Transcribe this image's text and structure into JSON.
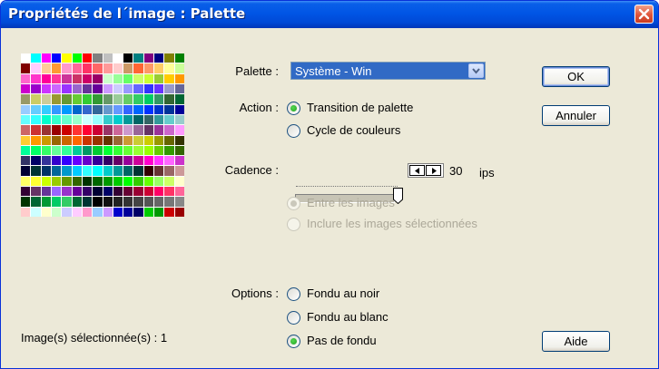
{
  "window": {
    "title": "Propriétés de l´image : Palette"
  },
  "palette_swatch_colors": [
    "#fff",
    "#00ffff",
    "#ff00ff",
    "#0000ff",
    "#ffff00",
    "#00ff00",
    "#ff0000",
    "#808080",
    "#c0c0c0",
    "#fff",
    "#000",
    "#008080",
    "#800080",
    "#000080",
    "#808000",
    "#008000",
    "#800000",
    "#ffccff",
    "#ffcc99",
    "#ff9933",
    "#ff99cc",
    "#ff6699",
    "#ff3366",
    "#ff6666",
    "#ff9999",
    "#ffcccc",
    "#cc9966",
    "#ff6633",
    "#ff9966",
    "#ffcc66",
    "#ffff99",
    "#ccff99",
    "#ff66cc",
    "#ff33cc",
    "#ff0099",
    "#ff3399",
    "#cc3399",
    "#cc3366",
    "#cc0066",
    "#990066",
    "#ccffcc",
    "#99ff99",
    "#66ff66",
    "#ccff66",
    "#ccff33",
    "#99cc33",
    "#ffcc00",
    "#ff9900",
    "#cc00cc",
    "#9900cc",
    "#cc33ff",
    "#cc66ff",
    "#9933ff",
    "#9966cc",
    "#663399",
    "#660099",
    "#cc99ff",
    "#ccccff",
    "#9999ff",
    "#6666ff",
    "#3333ff",
    "#6633ff",
    "#9999cc",
    "#666699",
    "#999966",
    "#cccc66",
    "#cccc99",
    "#999933",
    "#669933",
    "#66cc33",
    "#33cc33",
    "#339933",
    "#669966",
    "#99cc99",
    "#66cc66",
    "#33cc66",
    "#00cc66",
    "#339966",
    "#336633",
    "#006633",
    "#99ccff",
    "#66ccff",
    "#33ccff",
    "#3399ff",
    "#0099ff",
    "#0066cc",
    "#3366cc",
    "#336699",
    "#6699cc",
    "#6699ff",
    "#3366ff",
    "#0066ff",
    "#0033ff",
    "#0033cc",
    "#003399",
    "#000099",
    "#66ffff",
    "#33ffff",
    "#00ffcc",
    "#33ffcc",
    "#66ffcc",
    "#99ffcc",
    "#ccffff",
    "#99ffff",
    "#33cccc",
    "#00cccc",
    "#009999",
    "#006666",
    "#336666",
    "#339999",
    "#66cccc",
    "#99cccc",
    "#cc6666",
    "#cc3333",
    "#993333",
    "#990000",
    "#cc0000",
    "#ff3333",
    "#ff0033",
    "#cc0033",
    "#993366",
    "#cc6699",
    "#cc99cc",
    "#996699",
    "#663366",
    "#993399",
    "#cc66cc",
    "#ff99ff",
    "#ffcc33",
    "#ff9900",
    "#cc9900",
    "#996600",
    "#cc6600",
    "#ff6600",
    "#cc3300",
    "#993300",
    "#663300",
    "#996633",
    "#cc9933",
    "#cccc33",
    "#cccc00",
    "#999900",
    "#666600",
    "#333300",
    "#00ff99",
    "#00ff66",
    "#33ff66",
    "#66ff99",
    "#33ff99",
    "#00cc99",
    "#009966",
    "#00cc33",
    "#00ff33",
    "#33ff33",
    "#66ff33",
    "#99ff33",
    "#99ff00",
    "#66cc00",
    "#339900",
    "#336600",
    "#333366",
    "#000066",
    "#333399",
    "#3300cc",
    "#3300ff",
    "#6600ff",
    "#6600cc",
    "#330099",
    "#330066",
    "#660066",
    "#990099",
    "#cc0099",
    "#ff00cc",
    "#ff33ff",
    "#ff66ff",
    "#cc33cc",
    "#000033",
    "#003333",
    "#003366",
    "#006699",
    "#0099cc",
    "#00ccff",
    "#33ffff",
    "#00ffff",
    "#00cccc",
    "#009999",
    "#006666",
    "#003333",
    "#330000",
    "#663333",
    "#996666",
    "#cc9999",
    "#ffff66",
    "#ffff33",
    "#ccff00",
    "#99cc00",
    "#669900",
    "#336600",
    "#003300",
    "#006600",
    "#009900",
    "#00cc00",
    "#00ff00",
    "#33cc00",
    "#66ff00",
    "#99ff66",
    "#ccff66",
    "#ffffcc",
    "#330033",
    "#663366",
    "#663399",
    "#9966ff",
    "#9933cc",
    "#660099",
    "#330066",
    "#000033",
    "#000066",
    "#330033",
    "#660033",
    "#990033",
    "#cc0033",
    "#ff0066",
    "#ff3366",
    "#ff6699",
    "#003300",
    "#006633",
    "#009933",
    "#00cc66",
    "#33cc66",
    "#006633",
    "#003333",
    "#000000",
    "#111111",
    "#222222",
    "#333333",
    "#444444",
    "#555555",
    "#666666",
    "#777777",
    "#888888",
    "#ffcccc",
    "#ccffff",
    "#ffffcc",
    "#ccffcc",
    "#ccccff",
    "#ffccff",
    "#ff99cc",
    "#99ccff",
    "#cc99ff",
    "#0000cc",
    "#000099",
    "#000066",
    "#00cc00",
    "#009900",
    "#cc0000",
    "#990000"
  ],
  "labels": {
    "palette": "Palette :",
    "action": "Action :",
    "cadence": "Cadence :",
    "options": "Options :"
  },
  "palette_select": {
    "value": "Système - Win"
  },
  "action_options": [
    {
      "label": "Transition de palette",
      "checked": true
    },
    {
      "label": "Cycle de couleurs",
      "checked": false
    }
  ],
  "cadence": {
    "value": "30",
    "unit": "ips",
    "slider_level": 1.0
  },
  "frame_options": [
    {
      "label": "Entre les images",
      "checked": true,
      "enabled": false
    },
    {
      "label": "Inclure les images sélectionnées",
      "checked": false,
      "enabled": false
    }
  ],
  "fade_options": [
    {
      "label": "Fondu au noir",
      "checked": false
    },
    {
      "label": "Fondu au blanc",
      "checked": false
    },
    {
      "label": "Pas de fondu",
      "checked": true
    }
  ],
  "status": "Image(s) sélectionnée(s) : 1",
  "buttons": {
    "ok": "OK",
    "cancel": "Annuler",
    "help": "Aide"
  }
}
